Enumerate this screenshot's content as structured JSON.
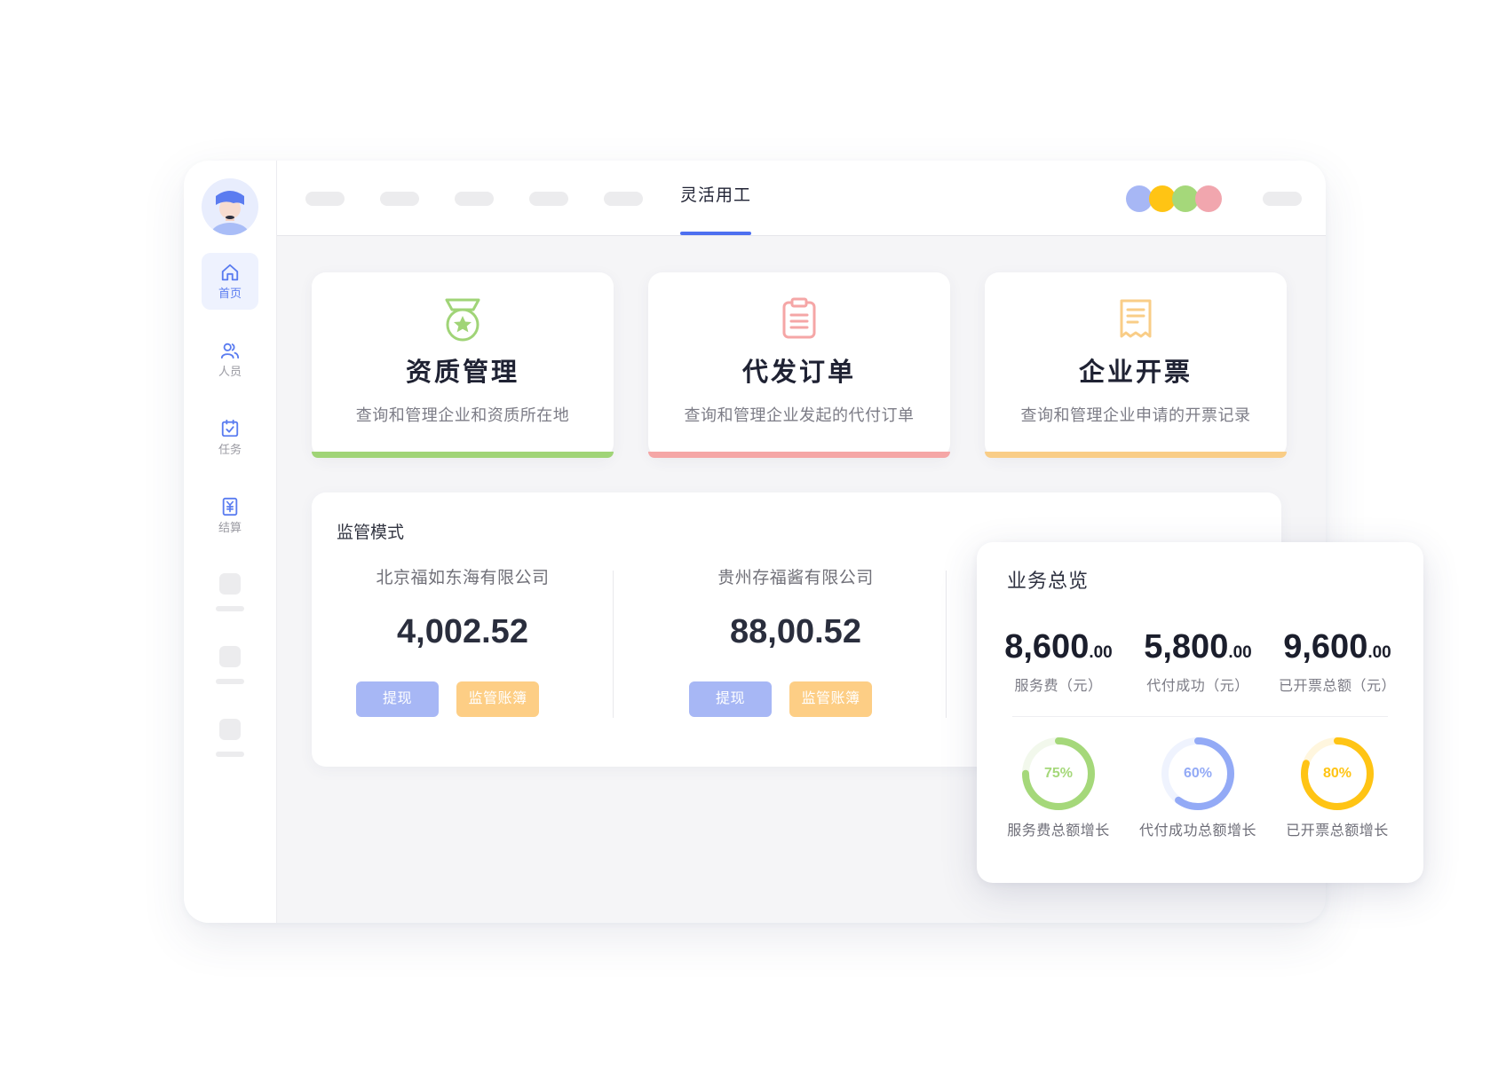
{
  "sidebar": {
    "items": [
      {
        "label": "首页",
        "icon": "home-icon",
        "active": true
      },
      {
        "label": "人员",
        "icon": "users-icon",
        "active": false
      },
      {
        "label": "任务",
        "icon": "task-calendar-icon",
        "active": false
      },
      {
        "label": "结算",
        "icon": "settlement-yen-icon",
        "active": false
      }
    ]
  },
  "topbar": {
    "active_tab": "灵活用工",
    "dot_colors": [
      "#a7b7f5",
      "#ffc414",
      "#a5d87a",
      "#f1a6ae"
    ]
  },
  "cards": [
    {
      "title": "资质管理",
      "desc": "查询和管理企业和资质所在地",
      "icon": "medal-icon",
      "color": "#a0d477"
    },
    {
      "title": "代发订单",
      "desc": "查询和管理企业发起的代付订单",
      "icon": "clipboard-icon",
      "color": "#f5a6a6"
    },
    {
      "title": "企业开票",
      "desc": "查询和管理企业申请的开票记录",
      "icon": "invoice-icon",
      "color": "#f9cd87"
    }
  ],
  "supervision": {
    "title": "监管模式",
    "accounts": [
      {
        "company": "北京福如东海有限公司",
        "amount": "4,002.52",
        "withdraw_label": "提现",
        "ledger_label": "监管账簿"
      },
      {
        "company": "贵州存福酱有限公司",
        "amount": "88,00.52",
        "withdraw_label": "提现",
        "ledger_label": "监管账簿"
      }
    ]
  },
  "overview": {
    "title": "业务总览",
    "stats": [
      {
        "int": "8,600",
        "dec": ".00",
        "label": "服务费（元）"
      },
      {
        "int": "5,800",
        "dec": ".00",
        "label": "代付成功（元）"
      },
      {
        "int": "9,600",
        "dec": ".00",
        "label": "已开票总额（元）"
      }
    ],
    "rings": [
      {
        "percent": 75,
        "text": "75%",
        "label": "服务费总额增长",
        "color": "#a5d87a",
        "track": "#f2f8ec"
      },
      {
        "percent": 60,
        "text": "60%",
        "label": "代付成功总额增长",
        "color": "#93aaf6",
        "track": "#eff3fe"
      },
      {
        "percent": 80,
        "text": "80%",
        "label": "已开票总额增长",
        "color": "#ffc414",
        "track": "#fff6de"
      }
    ]
  }
}
